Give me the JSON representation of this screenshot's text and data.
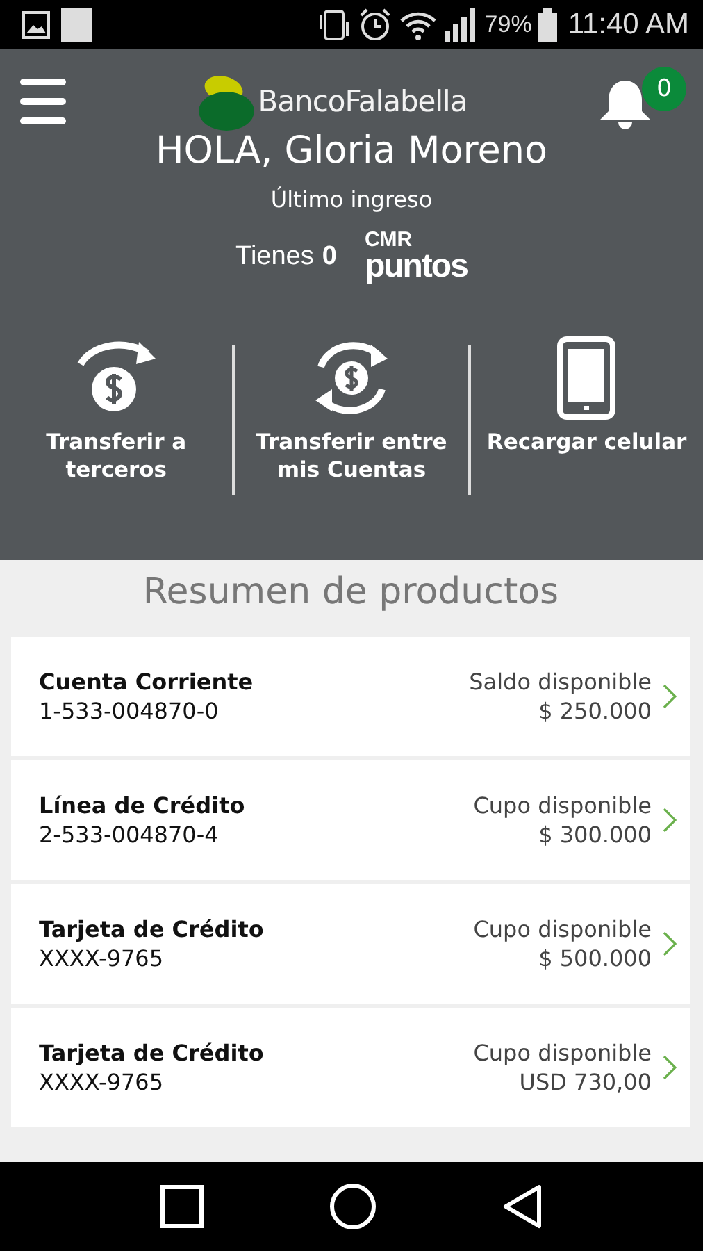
{
  "status_bar": {
    "battery": "79%",
    "time": "11:40 AM"
  },
  "header": {
    "brand": "BancoFalabella",
    "notifications": "0",
    "greeting": "HOLA, Gloria Moreno",
    "last_login": "Último ingreso",
    "points_prefix": "Tienes",
    "points": "0",
    "points_brand_top": "CMR",
    "points_brand_bottom": "puntos"
  },
  "actions": [
    {
      "kind": "send",
      "label": "Transferir a terceros"
    },
    {
      "kind": "exchange",
      "label": "Transferir entre mis Cuentas"
    },
    {
      "kind": "phone",
      "label": "Recargar celular"
    }
  ],
  "section_title": "Resumen de productos",
  "products": [
    {
      "name": "Cuenta Corriente",
      "number": "1-533-004870-0",
      "balance_label": "Saldo disponible",
      "amount": "$ 250.000"
    },
    {
      "name": "Línea de Crédito",
      "number": "2-533-004870-4",
      "balance_label": "Cupo disponible",
      "amount": "$ 300.000"
    },
    {
      "name": "Tarjeta de Crédito",
      "number": "XXXX-9765",
      "balance_label": "Cupo disponible",
      "amount": "$ 500.000"
    },
    {
      "name": "Tarjeta de Crédito",
      "number": "XXXX-9765",
      "balance_label": "Cupo disponible",
      "amount": "USD 730,00"
    }
  ]
}
